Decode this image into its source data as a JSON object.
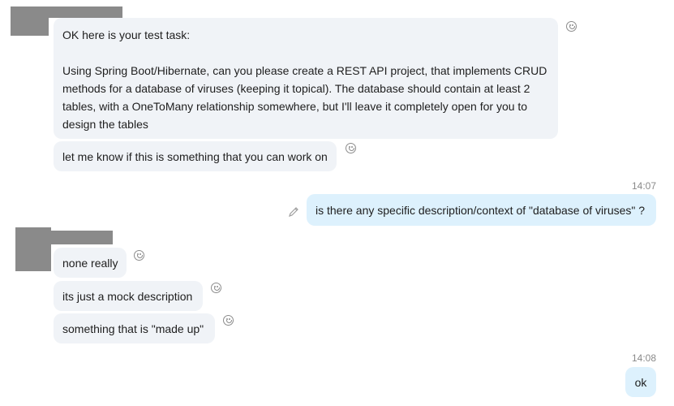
{
  "messages": {
    "m1": {
      "line1": "OK here is your test task:",
      "line2": "Using Spring Boot/Hibernate, can you please create a REST API project, that implements CRUD",
      "line3": "methods for a database of viruses (keeping it topical). The database should contain at least 2",
      "line4": "tables, with a OneToMany relationship somewhere, but I'll leave it completely open for you to",
      "line5": "design the tables"
    },
    "m2": "let me know if this is something that you can work on",
    "m3": "is there any specific description/context of \"database of viruses\" ?",
    "m4": "none really",
    "m5": "its just a mock description",
    "m6": "something that is \"made up\"",
    "m7": "ok"
  },
  "times": {
    "t1": "14:07",
    "t2": "14:08"
  },
  "icons": {
    "reaction": "smiley-icon",
    "edit": "pencil-icon",
    "avatar": "redacted-avatar"
  },
  "colors": {
    "incoming": "#f0f3f7",
    "outgoing": "#ddf1fd",
    "text": "#1e1e1e",
    "meta": "#8a8a8a"
  }
}
